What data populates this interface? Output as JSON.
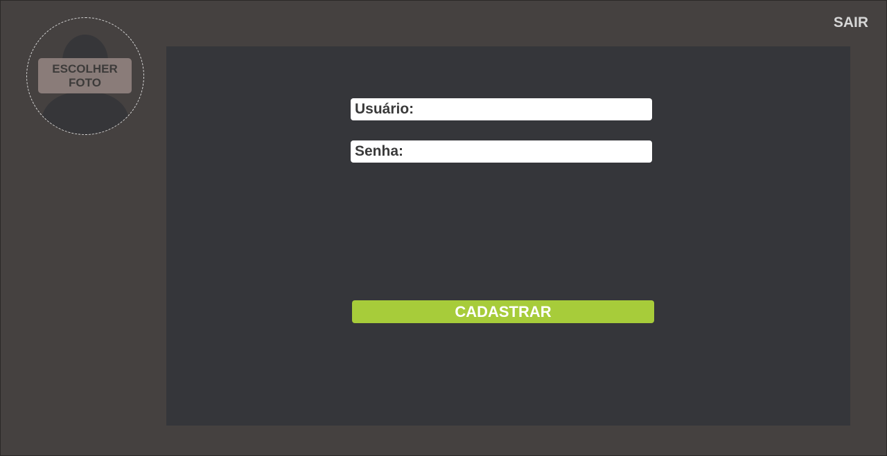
{
  "header": {
    "exit_label": "SAIR"
  },
  "avatar": {
    "icon": "user-silhouette-icon",
    "choose_photo_line1": "ESCOLHER",
    "choose_photo_line2": "FOTO"
  },
  "form": {
    "user_label": "Usuário:",
    "user_value": "",
    "password_label": "Senha:",
    "password_value": "",
    "submit_label": "CADASTRAR"
  },
  "colors": {
    "background": "#454140",
    "panel": "#35363a",
    "accent": "#a7cc3a",
    "input": "#ffffff"
  }
}
